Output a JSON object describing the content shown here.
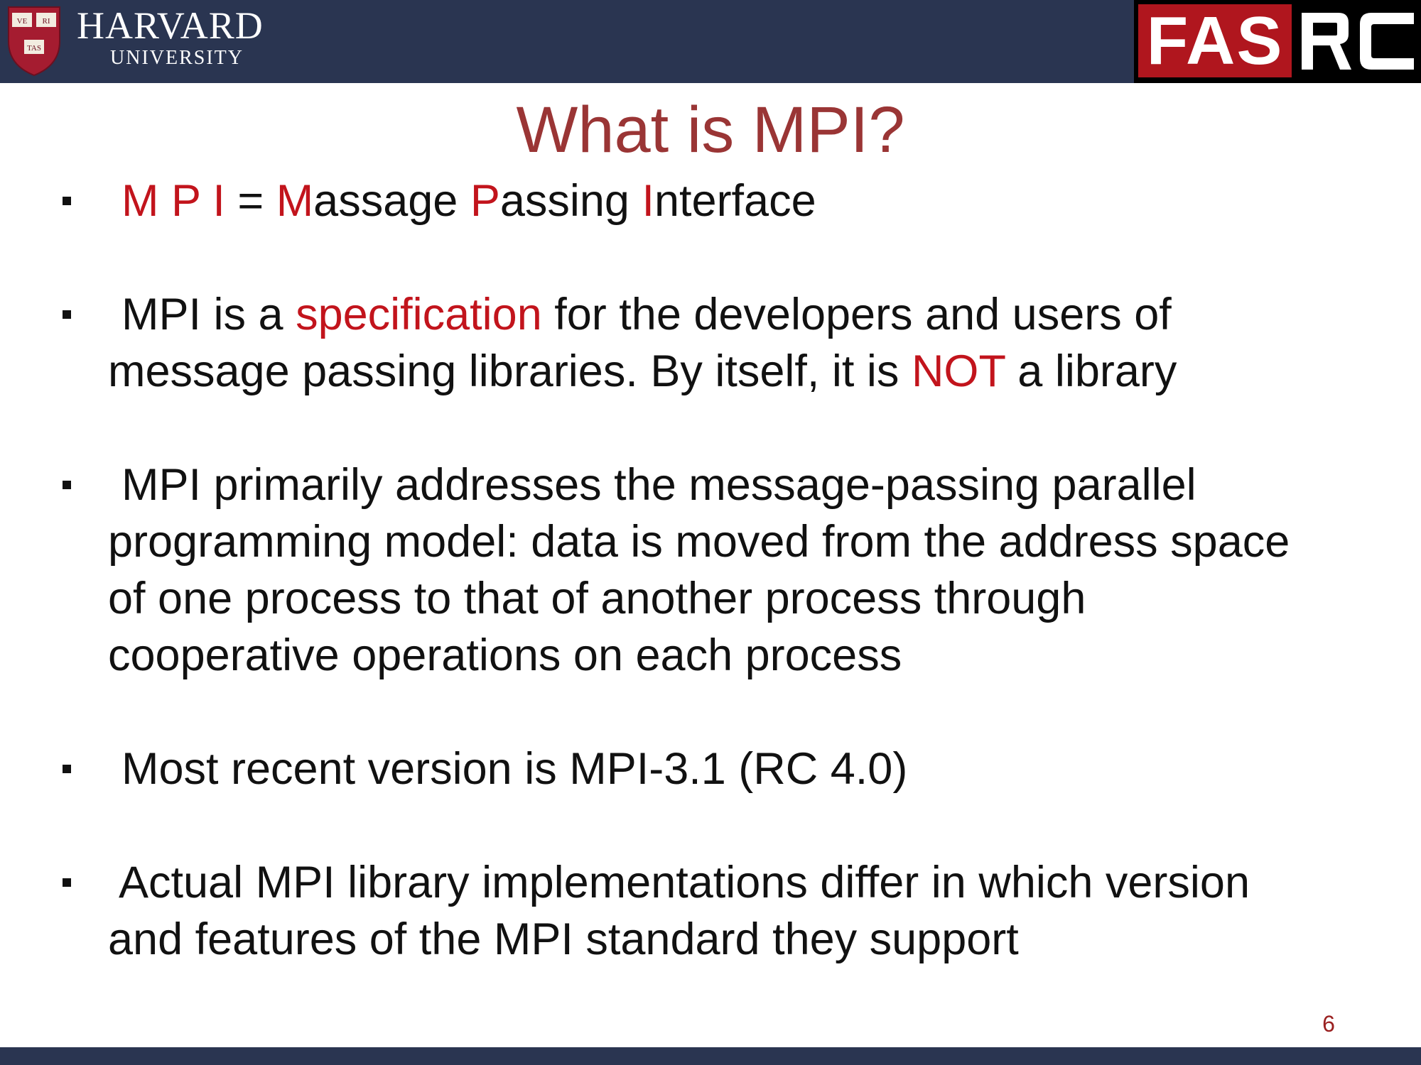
{
  "header": {
    "harvard": "HARVARD",
    "university": "UNIVERSITY",
    "shield_text": [
      "VE",
      "RI",
      "TAS"
    ],
    "fas": "FAS",
    "rc": "RC",
    "colors": {
      "bar": "#2a3551",
      "fas_red": "#b0161e",
      "accent": "#9a3535"
    }
  },
  "slide": {
    "title": "What is MPI?",
    "b1": {
      "p1": "M P I",
      "p2": " = ",
      "p3": "M",
      "p4": "assage ",
      "p5": "P",
      "p6": "assing ",
      "p7": "I",
      "p8": "nterface"
    },
    "b2": {
      "l1a": "MPI is a ",
      "l1b": "specification",
      "l1c": " for the developers and users of",
      "l2a": "message passing libraries. By itself, it is ",
      "l2b": "NOT",
      "l2c": " a library"
    },
    "b3": {
      "l1": "MPI primarily addresses the message-passing parallel",
      "l2": "programming model: data is moved from the address space",
      "l3": "of one process to that of another process through",
      "l4": "cooperative operations on each process"
    },
    "b4": {
      "l1": "Most recent version is MPI-3.1  (RC 4.0)"
    },
    "b5": {
      "l1": "Actual MPI library implementations differ in which version",
      "l2": "and features of the MPI standard they support"
    },
    "page_number": "6"
  }
}
